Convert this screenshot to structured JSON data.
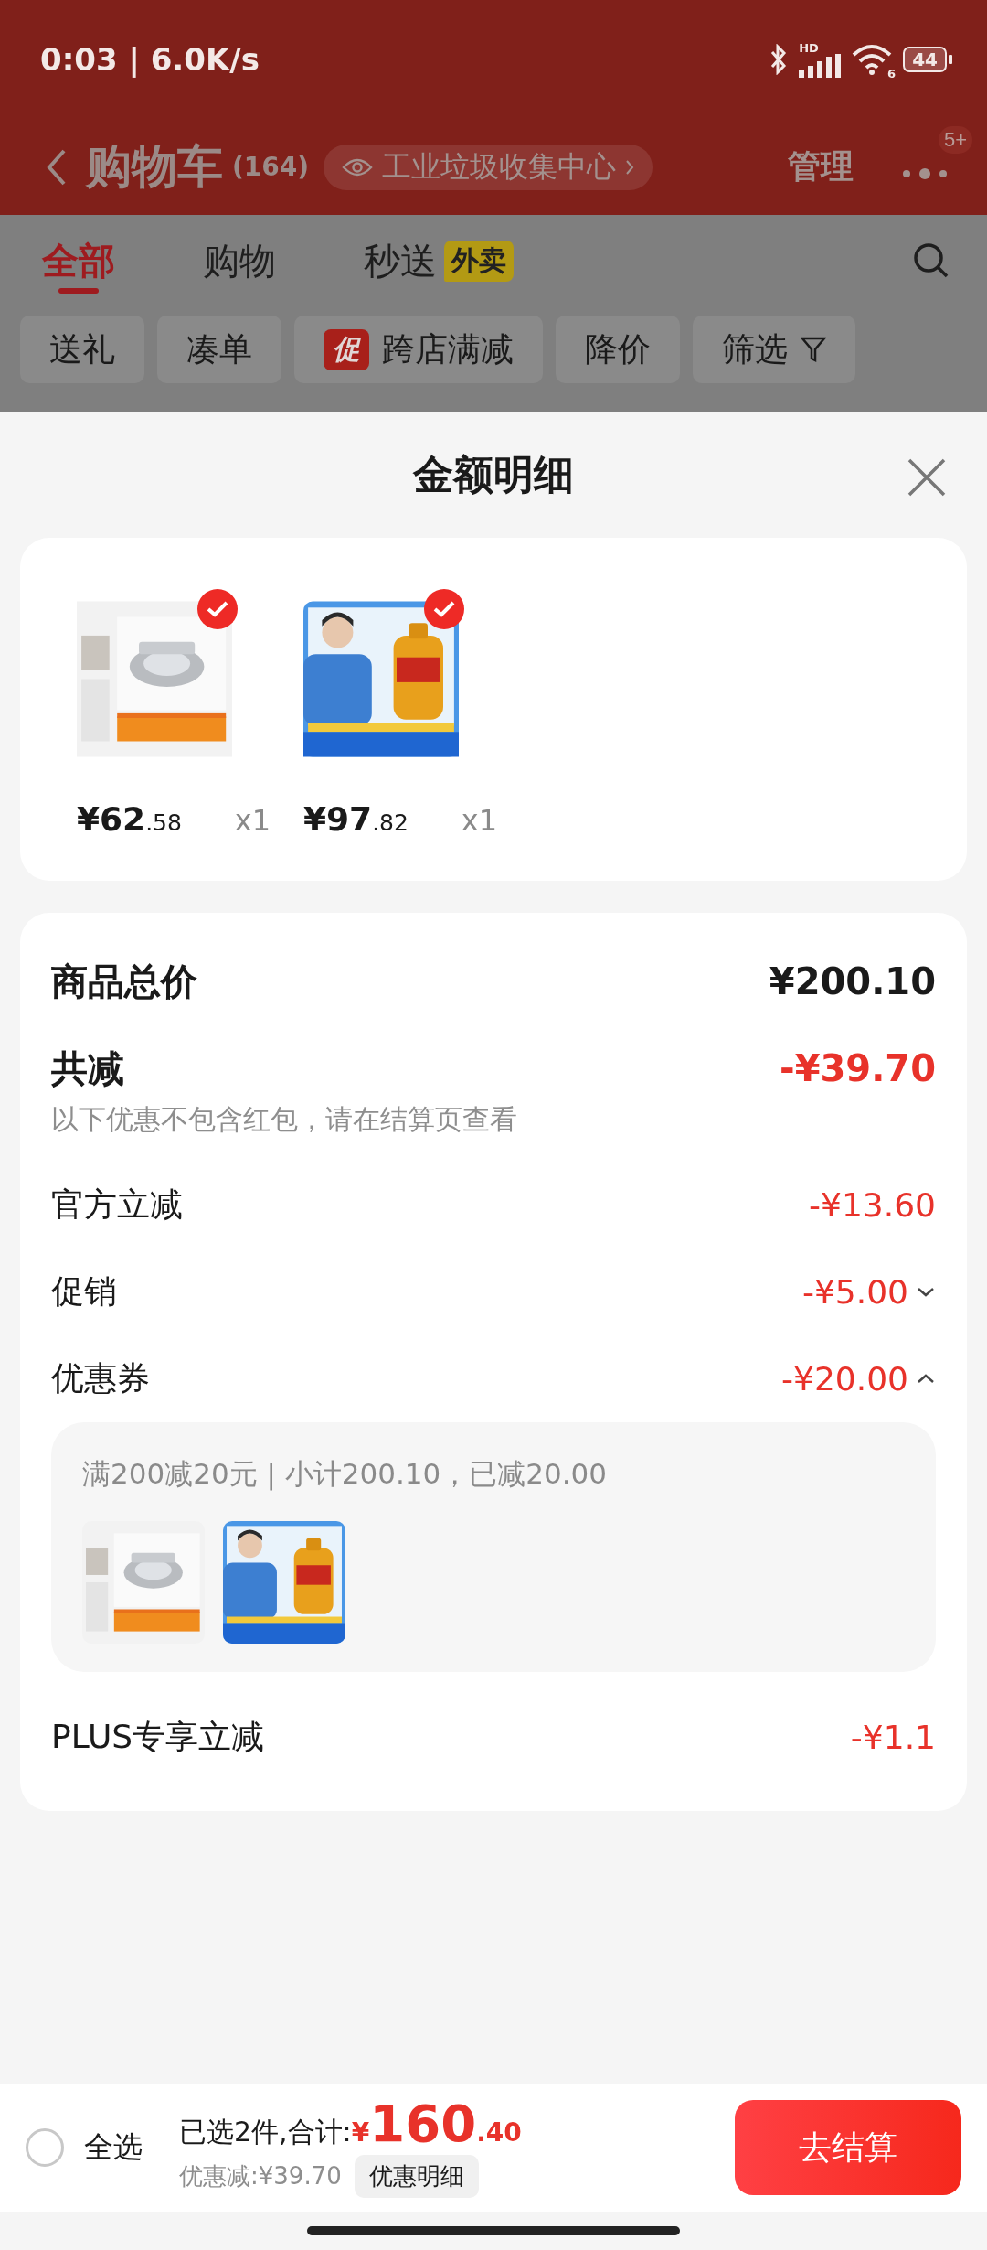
{
  "status_bar": {
    "time": "0:03 | 6.0K/s",
    "signal_label": "HD",
    "wifi_label": "6",
    "battery": "44"
  },
  "header": {
    "title": "购物车",
    "count": "(164)",
    "location": "工业垃圾收集中心",
    "manage": "管理",
    "more_badge": "5+"
  },
  "tabs": [
    {
      "label": "全部",
      "selected": true
    },
    {
      "label": "购物",
      "selected": false
    },
    {
      "label": "秒送",
      "badge": "外卖",
      "selected": false
    }
  ],
  "filters": [
    {
      "kind": "plain",
      "label": "送礼"
    },
    {
      "kind": "plain",
      "label": "凑单"
    },
    {
      "kind": "promo",
      "tag": "促",
      "label": "跨店满减"
    },
    {
      "kind": "plain",
      "label": "降价"
    },
    {
      "kind": "filter",
      "label": "筛选"
    }
  ],
  "sheet": {
    "title": "金额明细",
    "items": [
      {
        "kind": "picture",
        "price": "¥62",
        "price_decimal": ".58",
        "quantity": "x1",
        "checked": true
      },
      {
        "kind": "picture",
        "price": "¥97",
        "price_decimal": ".82",
        "quantity": "x1",
        "checked": true
      }
    ],
    "total": {
      "label": "商品总价",
      "value": "¥200.10"
    },
    "discount": {
      "label": "共减",
      "value": "-¥39.70",
      "note": "以下优惠不包含红包，请在结算页查看"
    },
    "rows": [
      {
        "kind": "plain",
        "label": "官方立减",
        "value": "-¥13.60"
      },
      {
        "kind": "toggle",
        "label": "促销",
        "value": "-¥5.00",
        "expanded": false
      },
      {
        "kind": "toggle",
        "label": "优惠券",
        "value": "-¥20.00",
        "expanded": true
      }
    ],
    "coupon_detail": {
      "text": "满200减20元 | 小计200.10，已减20.00"
    },
    "plus": {
      "label": "PLUS专享立减",
      "value": "-¥1.1"
    }
  },
  "bottom_bar": {
    "select_all": {
      "label": "全选",
      "checked": false
    },
    "summary": "已选2件,合计:",
    "currency": "¥",
    "amount": "160",
    "amount_decimal": ".40",
    "saved": "优惠减:¥39.70",
    "detail_button": "优惠明细",
    "checkout": "去结算"
  }
}
